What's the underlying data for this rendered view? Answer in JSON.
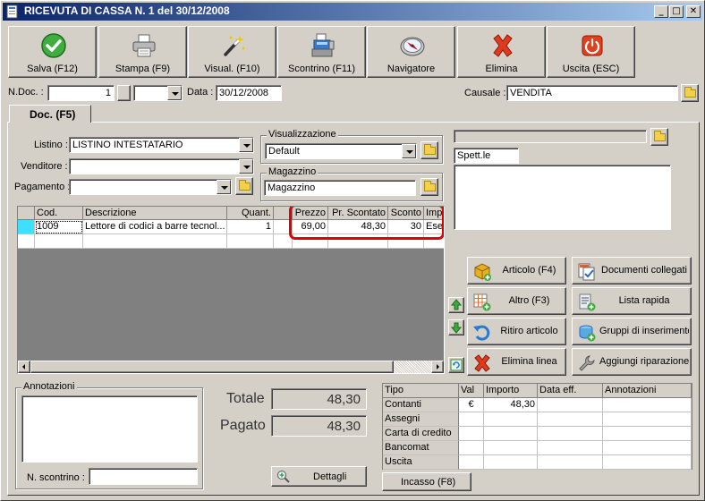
{
  "window": {
    "title": "RICEVUTA DI CASSA N. 1  del 30/12/2008",
    "min": "_",
    "max": "□",
    "close": "✕"
  },
  "toolbar": [
    {
      "id": "save",
      "label": "Salva (F12)",
      "icon": "check-icon"
    },
    {
      "id": "print",
      "label": "Stampa (F9)",
      "icon": "printer-icon"
    },
    {
      "id": "preview",
      "label": "Visual. (F10)",
      "icon": "wand-icon"
    },
    {
      "id": "receipt",
      "label": "Scontrino (F11)",
      "icon": "cash-register-icon"
    },
    {
      "id": "navigator",
      "label": "Navigatore",
      "icon": "compass-icon"
    },
    {
      "id": "delete",
      "label": "Elimina",
      "icon": "x-icon"
    },
    {
      "id": "exit",
      "label": "Uscita (ESC)",
      "icon": "power-icon"
    }
  ],
  "header": {
    "ndoc_label": "N.Doc. :",
    "ndoc_value": "1",
    "data_label": "Data :",
    "data_value": "30/12/2008",
    "causale_label": "Causale :",
    "causale_value": "VENDITA"
  },
  "tab": {
    "label": "Doc. (F5)"
  },
  "form": {
    "listino_label": "Listino :",
    "listino_value": "LISTINO INTESTATARIO",
    "venditore_label": "Venditore :",
    "venditore_value": "",
    "pagamento_label": "Pagamento :",
    "pagamento_value": "",
    "visualizzazione_title": "Visualizzazione",
    "visualizzazione_value": "Default",
    "magazzino_title": "Magazzino",
    "magazzino_value": "Magazzino",
    "spett_value": "Spett.le",
    "address_value": ""
  },
  "lines": {
    "columns": [
      "Cod.",
      "Descrizione",
      "Quant.",
      "Prezzo",
      "Pr. Scontato",
      "Sconto",
      "Impo"
    ],
    "rows": [
      {
        "cod": "1009",
        "descrizione": "Lettore di codici a barre tecnol...",
        "quant": "1",
        "prezzo": "69,00",
        "pr_scontato": "48,30",
        "sconto": "30",
        "impo": "Eser"
      }
    ]
  },
  "actions": [
    {
      "id": "articolo",
      "label": "Articolo (F4)",
      "icon": "box-add-icon"
    },
    {
      "id": "documenti",
      "label": "Documenti collegati",
      "icon": "docs-check-icon"
    },
    {
      "id": "altro",
      "label": "Altro (F3)",
      "icon": "grid-add-icon"
    },
    {
      "id": "lista",
      "label": "Lista rapida",
      "icon": "list-add-icon"
    },
    {
      "id": "ritiro",
      "label": "Ritiro articolo",
      "icon": "undo-icon"
    },
    {
      "id": "gruppi",
      "label": "Gruppi di inserimento",
      "icon": "group-add-icon"
    },
    {
      "id": "elimina_linea",
      "label": "Elimina linea",
      "icon": "x-icon"
    },
    {
      "id": "riparazione",
      "label": "Aggiungi riparazione",
      "icon": "wrench-icon"
    }
  ],
  "annotazioni": {
    "title": "Annotazioni",
    "value": "",
    "scontrino_label": "N. scontrino :",
    "scontrino_value": ""
  },
  "totals": {
    "totale_label": "Totale",
    "totale_value": "48,30",
    "pagato_label": "Pagato",
    "pagato_value": "48,30",
    "dettagli_label": "Dettagli"
  },
  "payments": {
    "columns": [
      "Tipo",
      "Val",
      "Importo",
      "Data eff.",
      "Annotazioni"
    ],
    "rows": [
      {
        "tipo": "Contanti",
        "val": "€",
        "importo": "48,30",
        "data": "",
        "note": ""
      },
      {
        "tipo": "Assegni",
        "val": "",
        "importo": "",
        "data": "",
        "note": ""
      },
      {
        "tipo": "Carta di credito",
        "val": "",
        "importo": "",
        "data": "",
        "note": ""
      },
      {
        "tipo": "Bancomat",
        "val": "",
        "importo": "",
        "data": "",
        "note": ""
      },
      {
        "tipo": "Uscita",
        "val": "",
        "importo": "",
        "data": "",
        "note": ""
      }
    ],
    "incasso_label": "Incasso (F8)"
  },
  "colors": {
    "title_start": "#0a246a",
    "title_end": "#a6caf0",
    "highlight": "#e00000",
    "face": "#d4d0c8",
    "grid_empty": "#808080"
  }
}
